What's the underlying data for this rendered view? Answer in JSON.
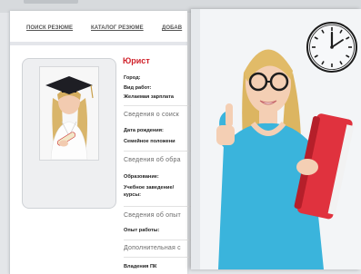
{
  "nav": {
    "search_resumes": "ПОИСК РЕЗЮМЕ",
    "resume_catalog": "КАТАЛОГ РЕЗЮМЕ",
    "add": "ДОБАВ"
  },
  "resume": {
    "title": "Юрист",
    "fields": {
      "city": "Город:",
      "work_type": "Вид работ:",
      "desired_salary": "Желаемая зарплата",
      "birth_date": "Дата рождения:",
      "marital_status": "Семейное положени",
      "education": "Образование:",
      "institution_line1": "Учебное заведение/",
      "institution_line2": "курсы:",
      "experience": "Опыт работы:",
      "pc_skills": "Владения ПК"
    },
    "sections": {
      "applicant_info": "Сведения о соиск",
      "education_info": "Сведения об обра",
      "experience_info": "Сведения об опыт",
      "additional": "Дополнительная с"
    }
  },
  "colors": {
    "title_red": "#d0212a",
    "shirt_blue": "#3ab4dc",
    "folder_red": "#e0323e"
  }
}
